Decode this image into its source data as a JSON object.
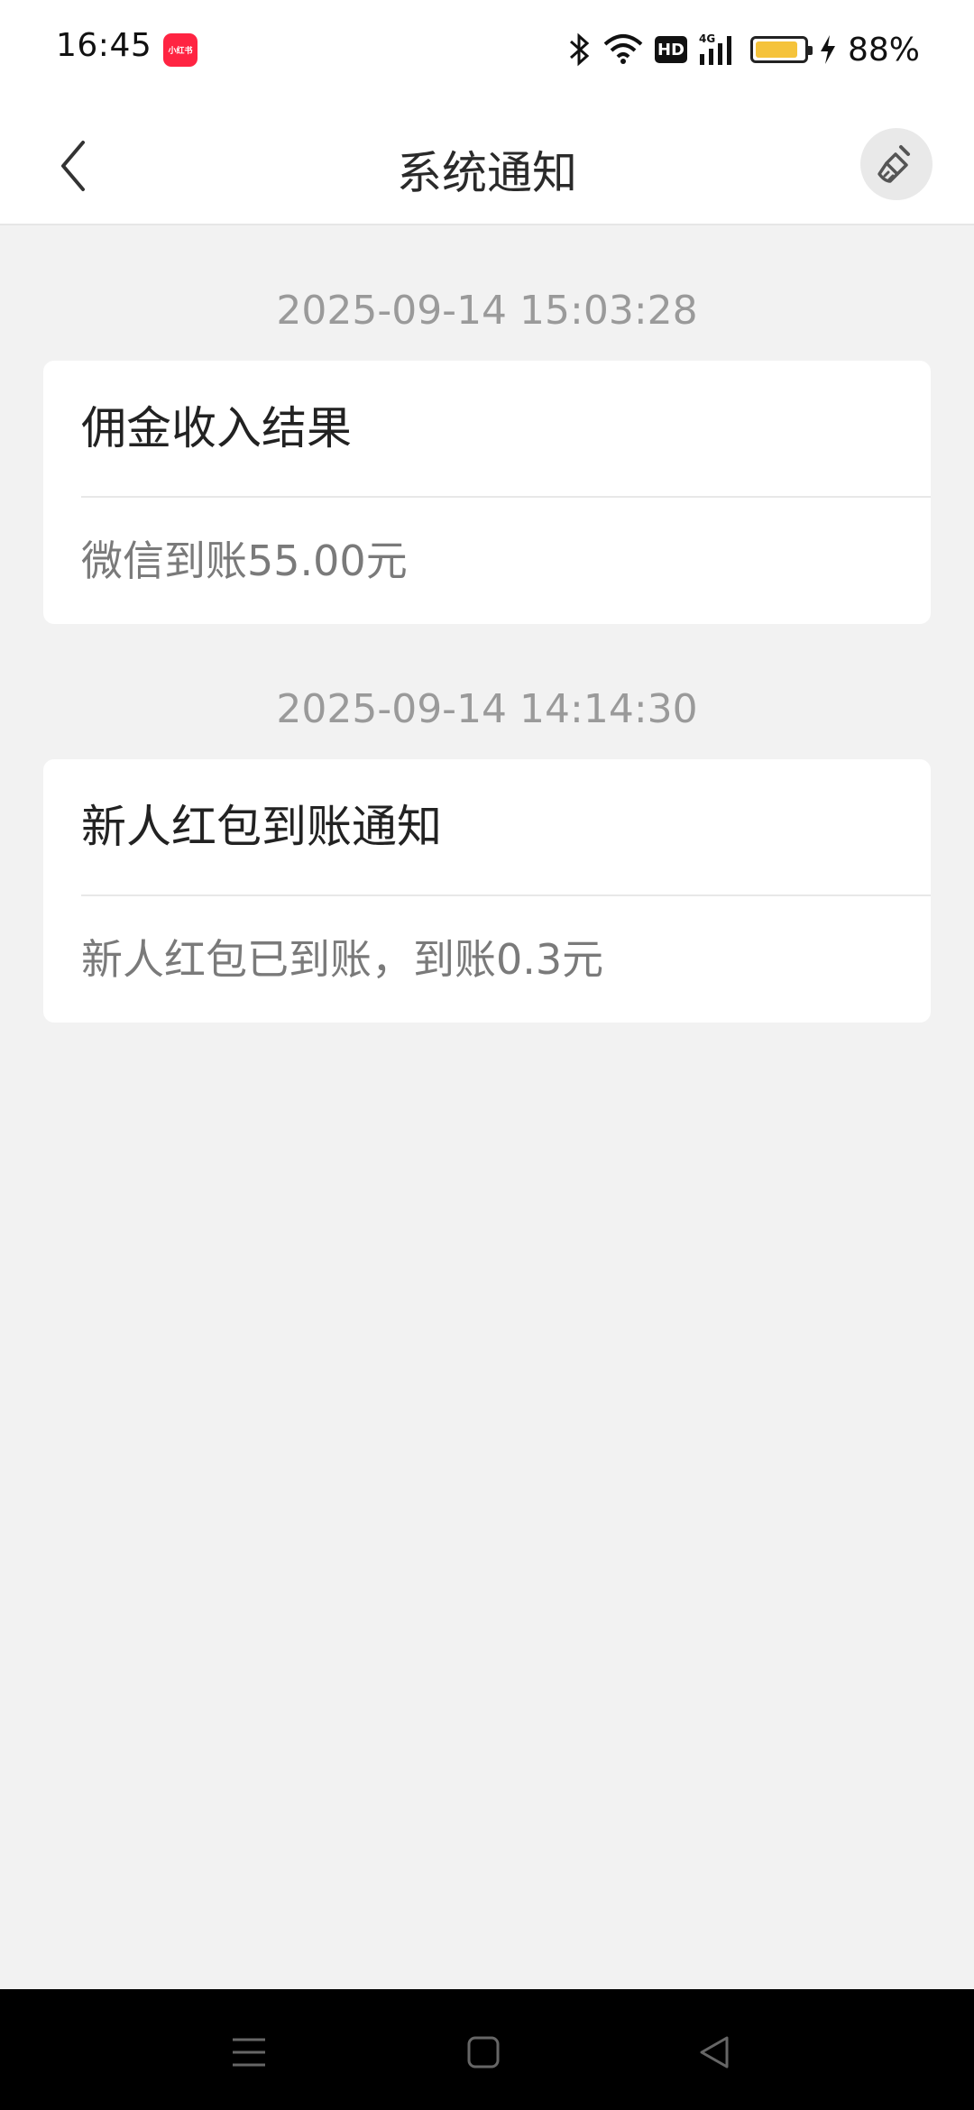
{
  "status_bar": {
    "time": "16:45",
    "app_badge": "小红书",
    "icons": [
      "bluetooth-icon",
      "wifi-icon",
      "hd-icon",
      "4g-signal-icon",
      "battery-icon",
      "charging-icon"
    ],
    "network_badge": "HD",
    "battery_percent": "88%",
    "battery_level": 0.88
  },
  "header": {
    "title": "系统通知",
    "back_icon": "chevron-left-icon",
    "clear_icon": "broom-icon"
  },
  "notifications": [
    {
      "timestamp": "2025-09-14 15:03:28",
      "title": "佣金收入结果",
      "body": "微信到账55.00元"
    },
    {
      "timestamp": "2025-09-14 14:14:30",
      "title": "新人红包到账通知",
      "body": "新人红包已到账，到账0.3元"
    }
  ],
  "system_nav": {
    "icons": [
      "menu-icon",
      "home-icon",
      "back-triangle-icon"
    ]
  },
  "colors": {
    "background": "#f2f2f2",
    "card": "#ffffff",
    "timestamp_text": "#9a9a9a",
    "brand_red": "#ff2442",
    "battery_fill": "#f5c33b"
  }
}
